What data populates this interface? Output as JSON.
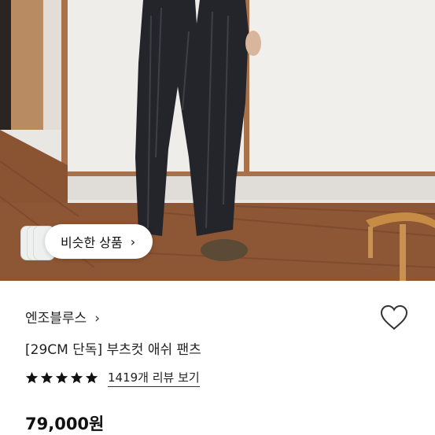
{
  "product_photo": {
    "description_icon": "product-photo",
    "floor_color": "#8a5433",
    "wall_color": "#e8e6e2",
    "pants_color": "#23232a"
  },
  "similar_products": {
    "label": "비슷한 상품",
    "chevron": "›"
  },
  "brand": {
    "name": "엔조블루스",
    "chevron": "›"
  },
  "product": {
    "title": "[29CM 단독] 부츠컷 애쉬 팬츠",
    "rating_stars": 5,
    "review_link": "1419개 리뷰 보기",
    "price": "79,000원"
  },
  "icons": {
    "wishlist": "heart-outline-icon",
    "star": "star-icon"
  },
  "colors": {
    "text": "#222222",
    "star": "#111111"
  }
}
